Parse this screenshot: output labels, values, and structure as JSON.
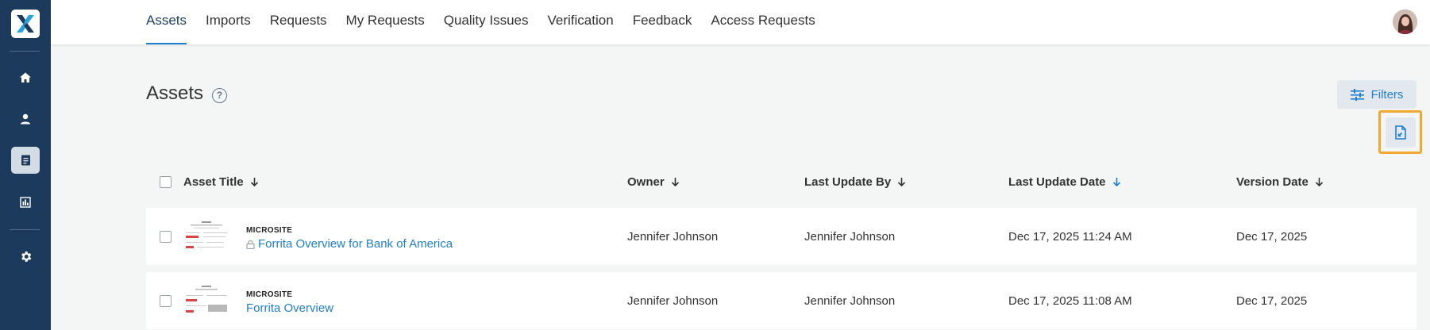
{
  "sidebar": {
    "items": [
      {
        "name": "home",
        "icon": "home-icon"
      },
      {
        "name": "users",
        "icon": "person-icon"
      },
      {
        "name": "assets",
        "icon": "document-icon",
        "active": true
      },
      {
        "name": "reports",
        "icon": "bar-chart-icon"
      },
      {
        "name": "settings",
        "icon": "gear-icon"
      }
    ]
  },
  "nav": {
    "tabs": [
      {
        "label": "Assets",
        "active": true
      },
      {
        "label": "Imports"
      },
      {
        "label": "Requests"
      },
      {
        "label": "My Requests"
      },
      {
        "label": "Quality Issues"
      },
      {
        "label": "Verification"
      },
      {
        "label": "Feedback"
      },
      {
        "label": "Access Requests"
      }
    ]
  },
  "page": {
    "title": "Assets",
    "help_symbol": "?",
    "filters_label": "Filters"
  },
  "table": {
    "columns": [
      "Asset Title",
      "Owner",
      "Last Update By",
      "Last Update Date",
      "Version Date"
    ],
    "rows": [
      {
        "type": "MICROSITE",
        "title": "Forrita Overview for Bank of America",
        "locked": true,
        "owner": "Jennifer Johnson",
        "updated_by": "Jennifer Johnson",
        "updated_date": "Dec 17, 2025 11:24 AM",
        "version_date": "Dec 17, 2025"
      },
      {
        "type": "MICROSITE",
        "title": "Forrita Overview",
        "locked": false,
        "owner": "Jennifer Johnson",
        "updated_by": "Jennifer Johnson",
        "updated_date": "Dec 17, 2025 11:08 AM",
        "version_date": "Dec 17, 2025"
      }
    ]
  },
  "colors": {
    "sidebar": "#1b3a5c",
    "accent": "#1f7fcf",
    "highlight": "#f0a830"
  }
}
